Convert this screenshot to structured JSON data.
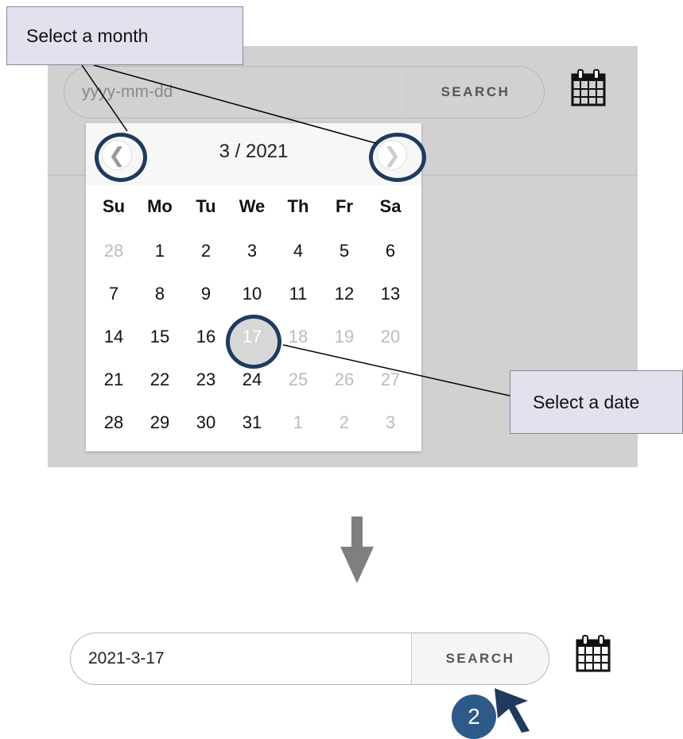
{
  "top": {
    "date_input": {
      "placeholder": "yyyy-mm-dd"
    },
    "search_label": "SEARCH"
  },
  "calendar": {
    "title": "3 / 2021",
    "prev_icon": "chevron-left-icon",
    "next_icon": "chevron-right-icon",
    "weekdays": [
      "Su",
      "Mo",
      "Tu",
      "We",
      "Th",
      "Fr",
      "Sa"
    ],
    "days": [
      "28",
      "1",
      "2",
      "3",
      "4",
      "5",
      "6",
      "7",
      "8",
      "9",
      "10",
      "11",
      "12",
      "13",
      "14",
      "15",
      "16",
      "17",
      "18",
      "19",
      "20",
      "21",
      "22",
      "23",
      "24",
      "25",
      "26",
      "27",
      "28",
      "29",
      "30",
      "31",
      "1",
      "2",
      "3"
    ],
    "selected_day": "17"
  },
  "callouts": {
    "month": "Select a month",
    "date": "Select a date"
  },
  "bottom": {
    "date_input": {
      "value": "2021-3-17"
    },
    "search_label": "SEARCH"
  },
  "step_badge": "2",
  "colors": {
    "panel": "#d1d1d1",
    "ring": "#1f3a5f",
    "callout_fill": "#e4e0ee",
    "badge": "#2e5a8a",
    "arrow": "#7f7f7f"
  }
}
